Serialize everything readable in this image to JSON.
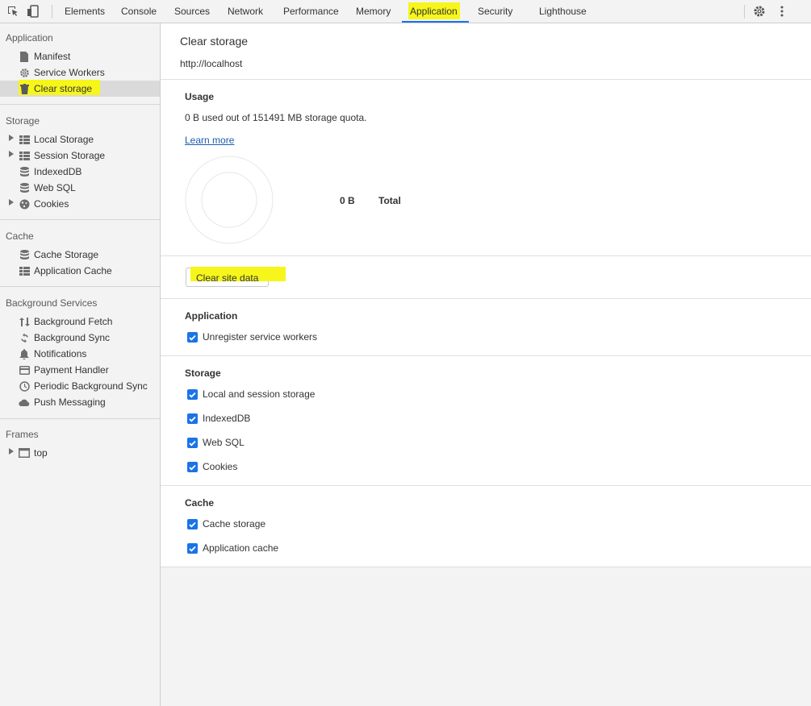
{
  "toolbar": {
    "tabs": [
      "Elements",
      "Console",
      "Sources",
      "Network",
      "Performance",
      "Memory",
      "Application",
      "Security",
      "Lighthouse"
    ],
    "active_tab": "Application",
    "accent_color": "#1a73e8",
    "highlight_color": "#f6f61b"
  },
  "sidebar": {
    "application": {
      "title": "Application",
      "items": [
        {
          "label": "Manifest",
          "icon": "document-icon"
        },
        {
          "label": "Service Workers",
          "icon": "gear-icon"
        },
        {
          "label": "Clear storage",
          "icon": "trash-icon",
          "selected": true
        }
      ]
    },
    "storage": {
      "title": "Storage",
      "items": [
        {
          "label": "Local Storage",
          "icon": "grid-icon",
          "expandable": true
        },
        {
          "label": "Session Storage",
          "icon": "grid-icon",
          "expandable": true
        },
        {
          "label": "IndexedDB",
          "icon": "database-icon"
        },
        {
          "label": "Web SQL",
          "icon": "database-icon"
        },
        {
          "label": "Cookies",
          "icon": "cookie-icon",
          "expandable": true
        }
      ]
    },
    "cache": {
      "title": "Cache",
      "items": [
        {
          "label": "Cache Storage",
          "icon": "database-icon"
        },
        {
          "label": "Application Cache",
          "icon": "grid-icon"
        }
      ]
    },
    "background": {
      "title": "Background Services",
      "items": [
        {
          "label": "Background Fetch",
          "icon": "arrows-updown-icon"
        },
        {
          "label": "Background Sync",
          "icon": "sync-icon"
        },
        {
          "label": "Notifications",
          "icon": "bell-icon"
        },
        {
          "label": "Payment Handler",
          "icon": "card-icon"
        },
        {
          "label": "Periodic Background Sync",
          "icon": "clock-icon"
        },
        {
          "label": "Push Messaging",
          "icon": "cloud-icon"
        }
      ]
    },
    "frames": {
      "title": "Frames",
      "items": [
        {
          "label": "top",
          "icon": "frame-icon",
          "expandable": true
        }
      ]
    }
  },
  "main": {
    "title": "Clear storage",
    "origin": "http://localhost",
    "usage": {
      "heading": "Usage",
      "summary": "0 B used out of 151491 MB storage quota.",
      "learn_more": "Learn more",
      "total_value": "0 B",
      "total_label": "Total"
    },
    "clear_button": "Clear site data",
    "groups": [
      {
        "heading": "Application",
        "options": [
          {
            "label": "Unregister service workers",
            "checked": true
          }
        ]
      },
      {
        "heading": "Storage",
        "options": [
          {
            "label": "Local and session storage",
            "checked": true
          },
          {
            "label": "IndexedDB",
            "checked": true
          },
          {
            "label": "Web SQL",
            "checked": true
          },
          {
            "label": "Cookies",
            "checked": true
          }
        ]
      },
      {
        "heading": "Cache",
        "options": [
          {
            "label": "Cache storage",
            "checked": true
          },
          {
            "label": "Application cache",
            "checked": true
          }
        ]
      }
    ]
  }
}
